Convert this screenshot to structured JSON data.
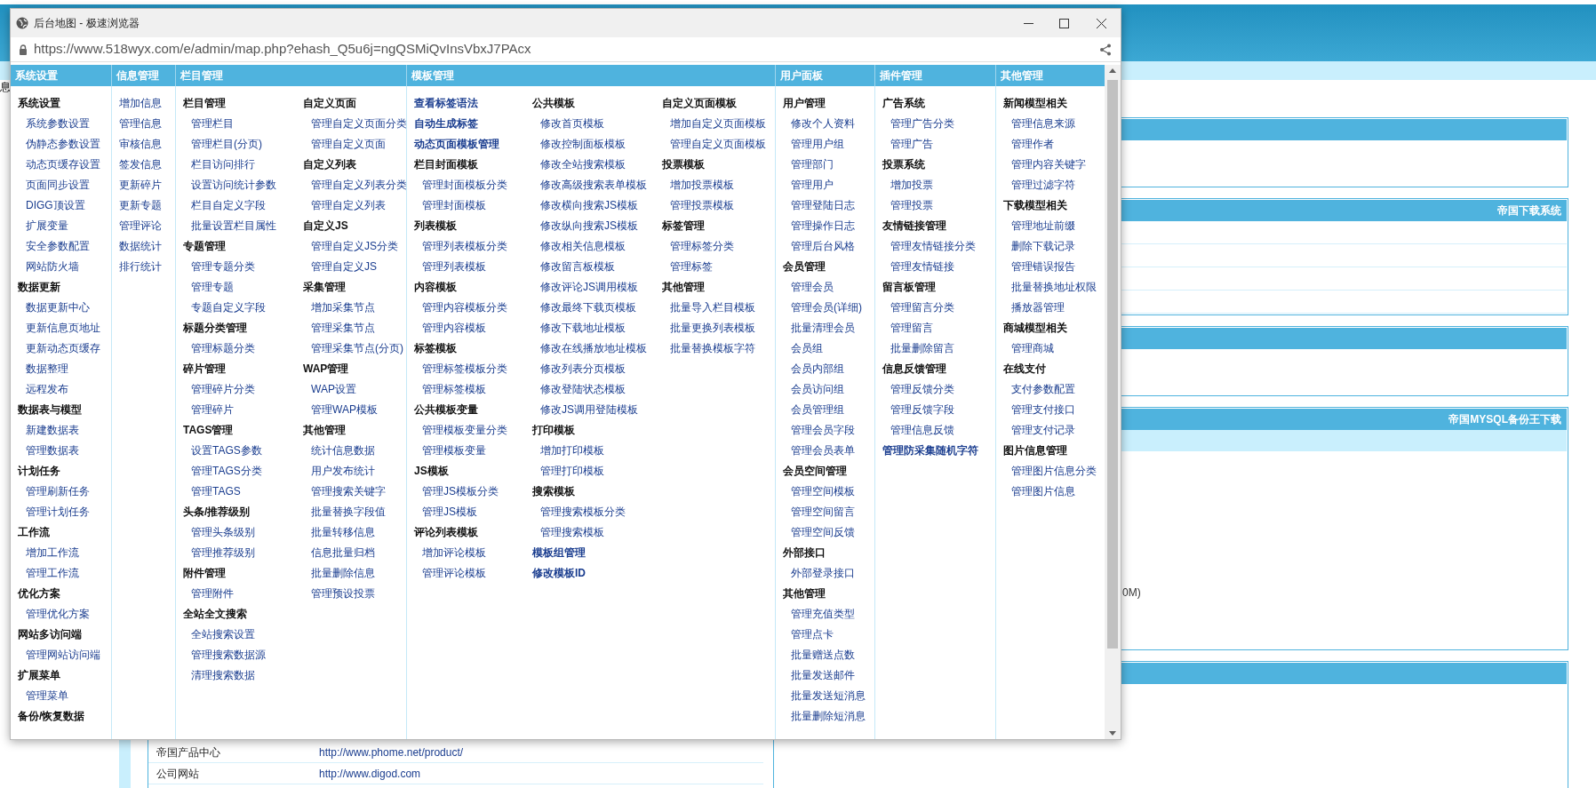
{
  "background": {
    "side_text": "息",
    "panels": [
      {
        "kind": "plain"
      },
      {
        "kind": "table",
        "title": "帝国下载系统"
      },
      {
        "kind": "plain"
      },
      {
        "kind": "banded",
        "title": "帝国MYSQL备份王下载",
        "text": "0M)"
      },
      {
        "kind": "plain"
      }
    ],
    "links": [
      {
        "label": "帝国产品中心",
        "url": "http://www.phome.net/product/"
      },
      {
        "label": "公司网站",
        "url": "http://www.digod.com"
      }
    ]
  },
  "window": {
    "title": "后台地图 - 极速浏览器",
    "url": "https://www.518wyx.com/e/admin/map.php?ehash_Q5u6j=ngQSMiQvInsVbxJ7PAcx"
  },
  "columns": [
    {
      "title": "系统设置",
      "subcolumns": [
        [
          {
            "kind": "group",
            "title": "系统设置",
            "items": [
              "系统参数设置",
              "伪静态参数设置",
              "动态页缓存设置",
              "页面同步设置",
              "DIGG顶设置",
              "扩展变量",
              "安全参数配置",
              "网站防火墙"
            ]
          },
          {
            "kind": "group",
            "title": "数据更新",
            "items": [
              "数据更新中心",
              "更新信息页地址",
              "更新动态页缓存",
              "数据整理",
              "远程发布"
            ]
          },
          {
            "kind": "group",
            "title": "数据表与模型",
            "items": [
              "新建数据表",
              "管理数据表"
            ]
          },
          {
            "kind": "group",
            "title": "计划任务",
            "items": [
              "管理刷新任务",
              "管理计划任务"
            ]
          },
          {
            "kind": "group",
            "title": "工作流",
            "items": [
              "增加工作流",
              "管理工作流"
            ]
          },
          {
            "kind": "group",
            "title": "优化方案",
            "items": [
              "管理优化方案"
            ]
          },
          {
            "kind": "group",
            "title": "网站多访问端",
            "items": [
              "管理网站访问端"
            ]
          },
          {
            "kind": "group",
            "title": "扩展菜单",
            "items": [
              "管理菜单"
            ]
          },
          {
            "kind": "group",
            "title": "备份/恢复数据"
          }
        ]
      ]
    },
    {
      "title": "信息管理",
      "subcolumns": [
        [
          {
            "kind": "list",
            "items": [
              "增加信息",
              "管理信息",
              "审核信息",
              "签发信息",
              "更新碎片",
              "更新专题",
              "管理评论",
              "数据统计",
              "排行统计"
            ]
          }
        ]
      ]
    },
    {
      "title": "栏目管理",
      "subcolumns": [
        [
          {
            "kind": "group",
            "title": "栏目管理",
            "items": [
              "管理栏目",
              "管理栏目(分页)",
              "栏目访问排行",
              "设置访问统计参数",
              "栏目自定义字段",
              "批量设置栏目属性"
            ]
          },
          {
            "kind": "group",
            "title": "专题管理",
            "items": [
              "管理专题分类",
              "管理专题",
              "专题自定义字段"
            ]
          },
          {
            "kind": "group",
            "title": "标题分类管理",
            "items": [
              "管理标题分类"
            ]
          },
          {
            "kind": "group",
            "title": "碎片管理",
            "items": [
              "管理碎片分类",
              "管理碎片"
            ]
          },
          {
            "kind": "group",
            "title": "TAGS管理",
            "items": [
              "设置TAGS参数",
              "管理TAGS分类",
              "管理TAGS"
            ]
          },
          {
            "kind": "group",
            "title": "头条/推荐级别",
            "items": [
              "管理头条级别",
              "管理推荐级别"
            ]
          },
          {
            "kind": "group",
            "title": "附件管理",
            "items": [
              "管理附件"
            ]
          },
          {
            "kind": "group",
            "title": "全站全文搜索",
            "items": [
              "全站搜索设置",
              "管理搜索数据源",
              "清理搜索数据"
            ]
          }
        ],
        [
          {
            "kind": "group",
            "title": "自定义页面",
            "items": [
              "管理自定义页面分类",
              "管理自定义页面"
            ]
          },
          {
            "kind": "group",
            "title": "自定义列表",
            "items": [
              "管理自定义列表分类",
              "管理自定义列表"
            ]
          },
          {
            "kind": "group",
            "title": "自定义JS",
            "items": [
              "管理自定义JS分类",
              "管理自定义JS"
            ]
          },
          {
            "kind": "group",
            "title": "采集管理",
            "items": [
              "增加采集节点",
              "管理采集节点",
              "管理采集节点(分页)"
            ]
          },
          {
            "kind": "group",
            "title": "WAP管理",
            "items": [
              "WAP设置",
              "管理WAP模板"
            ]
          },
          {
            "kind": "group",
            "title": "其他管理",
            "items": [
              "统计信息数据",
              "用户发布统计",
              "管理搜索关键字",
              "批量替换字段值",
              "批量转移信息",
              "信息批量归档",
              "批量删除信息",
              "管理预设投票"
            ]
          }
        ]
      ]
    },
    {
      "title": "模板管理",
      "subcolumns": [
        [
          {
            "kind": "link",
            "title": "查看标签语法"
          },
          {
            "kind": "link",
            "title": "自动生成标签"
          },
          {
            "kind": "link",
            "title": "动态页面模板管理"
          },
          {
            "kind": "group",
            "title": "栏目封面模板",
            "items": [
              "管理封面模板分类",
              "管理封面模板"
            ]
          },
          {
            "kind": "group",
            "title": "列表模板",
            "items": [
              "管理列表模板分类",
              "管理列表模板"
            ]
          },
          {
            "kind": "group",
            "title": "内容模板",
            "items": [
              "管理内容模板分类",
              "管理内容模板"
            ]
          },
          {
            "kind": "group",
            "title": "标签模板",
            "items": [
              "管理标签模板分类",
              "管理标签模板"
            ]
          },
          {
            "kind": "group",
            "title": "公共模板变量",
            "items": [
              "管理模板变量分类",
              "管理模板变量"
            ]
          },
          {
            "kind": "group",
            "title": "JS模板",
            "items": [
              "管理JS模板分类",
              "管理JS模板"
            ]
          },
          {
            "kind": "group",
            "title": "评论列表模板",
            "items": [
              "增加评论模板",
              "管理评论模板"
            ]
          }
        ],
        [
          {
            "kind": "group",
            "title": "公共模板",
            "items": [
              "修改首页模板",
              "修改控制面板模板",
              "修改全站搜索模板",
              "修改高级搜索表单模板",
              "修改横向搜索JS模板",
              "修改纵向搜索JS模板",
              "修改相关信息模板",
              "修改留言板模板",
              "修改评论JS调用模板",
              "修改最终下载页模板",
              "修改下载地址模板",
              "修改在线播放地址模板",
              "修改列表分页模板",
              "修改登陆状态模板",
              "修改JS调用登陆模板"
            ]
          },
          {
            "kind": "group",
            "title": "打印模板",
            "items": [
              "增加打印模板",
              "管理打印模板"
            ]
          },
          {
            "kind": "group",
            "title": "搜索模板",
            "items": [
              "管理搜索模板分类",
              "管理搜索模板"
            ]
          },
          {
            "kind": "link",
            "title": "模板组管理"
          },
          {
            "kind": "link",
            "title": "修改模板ID"
          }
        ],
        [
          {
            "kind": "group",
            "title": "自定义页面模板",
            "items": [
              "增加自定义页面模板",
              "管理自定义页面模板"
            ]
          },
          {
            "kind": "group",
            "title": "投票模板",
            "items": [
              "增加投票模板",
              "管理投票模板"
            ]
          },
          {
            "kind": "group",
            "title": "标签管理",
            "items": [
              "管理标签分类",
              "管理标签"
            ]
          },
          {
            "kind": "group",
            "title": "其他管理",
            "items": [
              "批量导入栏目模板",
              "批量更换列表模板",
              "批量替换模板字符"
            ]
          }
        ]
      ]
    },
    {
      "title": "用户面板",
      "subcolumns": [
        [
          {
            "kind": "group",
            "title": "用户管理",
            "items": [
              "修改个人资料",
              "管理用户组",
              "管理部门",
              "管理用户",
              "管理登陆日志",
              "管理操作日志",
              "管理后台风格"
            ]
          },
          {
            "kind": "group",
            "title": "会员管理",
            "items": [
              "管理会员",
              "管理会员(详细)",
              "批量清理会员",
              "会员组",
              "会员内部组",
              "会员访问组",
              "会员管理组",
              "管理会员字段",
              "管理会员表单"
            ]
          },
          {
            "kind": "group",
            "title": "会员空间管理",
            "items": [
              "管理空间模板",
              "管理空间留言",
              "管理空间反馈"
            ]
          },
          {
            "kind": "group",
            "title": "外部接口",
            "items": [
              "外部登录接口"
            ]
          },
          {
            "kind": "group",
            "title": "其他管理",
            "items": [
              "管理充值类型",
              "管理点卡",
              "批量赠送点数",
              "批量发送邮件",
              "批量发送短消息",
              "批量删除短消息"
            ]
          }
        ]
      ]
    },
    {
      "title": "插件管理",
      "subcolumns": [
        [
          {
            "kind": "group",
            "title": "广告系统",
            "items": [
              "管理广告分类",
              "管理广告"
            ]
          },
          {
            "kind": "group",
            "title": "投票系统",
            "items": [
              "增加投票",
              "管理投票"
            ]
          },
          {
            "kind": "group",
            "title": "友情链接管理",
            "items": [
              "管理友情链接分类",
              "管理友情链接"
            ]
          },
          {
            "kind": "group",
            "title": "留言板管理",
            "items": [
              "管理留言分类",
              "管理留言",
              "批量删除留言"
            ]
          },
          {
            "kind": "group",
            "title": "信息反馈管理",
            "items": [
              "管理反馈分类",
              "管理反馈字段",
              "管理信息反馈"
            ]
          },
          {
            "kind": "link",
            "title": "管理防采集随机字符"
          }
        ]
      ]
    },
    {
      "title": "其他管理",
      "subcolumns": [
        [
          {
            "kind": "group",
            "title": "新闻模型相关",
            "items": [
              "管理信息来源",
              "管理作者",
              "管理内容关键字",
              "管理过滤字符"
            ]
          },
          {
            "kind": "group",
            "title": "下载模型相关",
            "items": [
              "管理地址前缀",
              "删除下载记录",
              "管理错误报告",
              "批量替换地址权限",
              "播放器管理"
            ]
          },
          {
            "kind": "group",
            "title": "商城模型相关",
            "items": [
              "管理商城"
            ]
          },
          {
            "kind": "group",
            "title": "在线支付",
            "items": [
              "支付参数配置",
              "管理支付接口",
              "管理支付记录"
            ]
          },
          {
            "kind": "group",
            "title": "图片信息管理",
            "items": [
              "管理图片信息分类",
              "管理图片信息"
            ]
          }
        ]
      ]
    }
  ]
}
